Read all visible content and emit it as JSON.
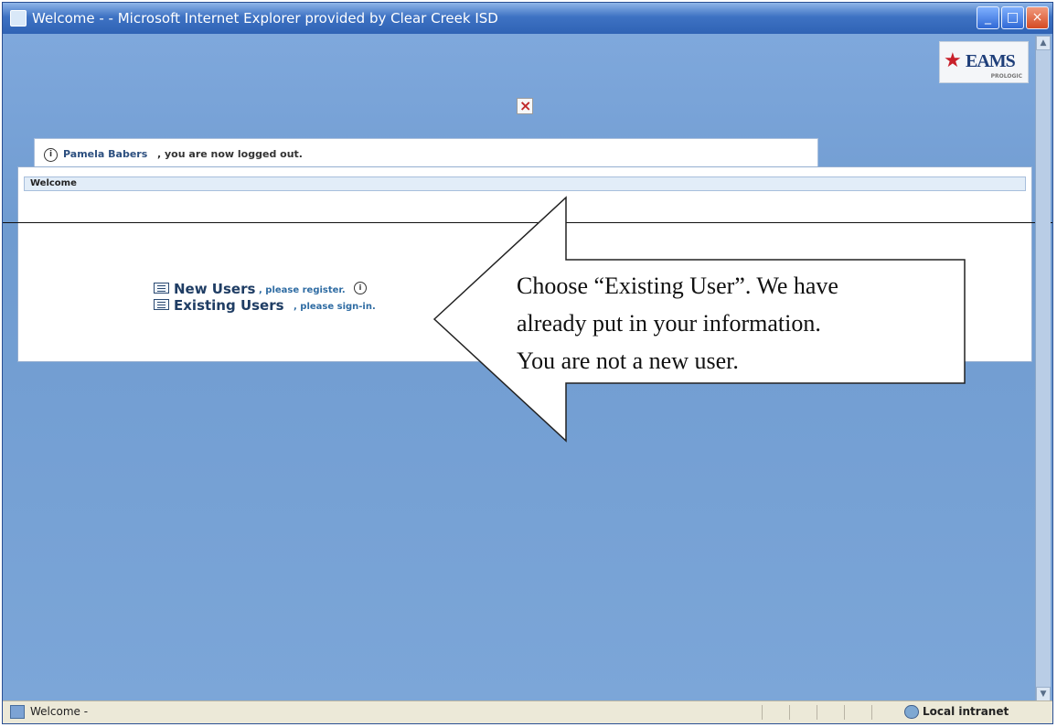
{
  "window": {
    "title": "Welcome - - Microsoft Internet Explorer provided by Clear Creek ISD",
    "buttons": {
      "minimize": "_",
      "maximize": "□",
      "close": "×"
    }
  },
  "logo": {
    "text": "EAMS",
    "subtext": "PROLOGIC"
  },
  "notice": {
    "name": "Pamela Babers",
    "message": ", you are now logged out."
  },
  "panel": {
    "header": "Welcome"
  },
  "links": {
    "new_users": {
      "label": "New Users",
      "suffix": ", please register."
    },
    "existing_users": {
      "label": "Existing Users",
      "suffix": ", please sign-in."
    }
  },
  "callout": {
    "line1": "Choose “Existing User”.  We have",
    "line2": "already put in your information.",
    "line3": "You are not a new user."
  },
  "statusbar": {
    "text": "Welcome -",
    "zone": "Local intranet"
  },
  "icons": {
    "app": "ie-icon",
    "info": "info-icon",
    "broken_image": "broken-image-icon",
    "link_icon": "list-icon",
    "zone_icon": "globe-icon"
  }
}
